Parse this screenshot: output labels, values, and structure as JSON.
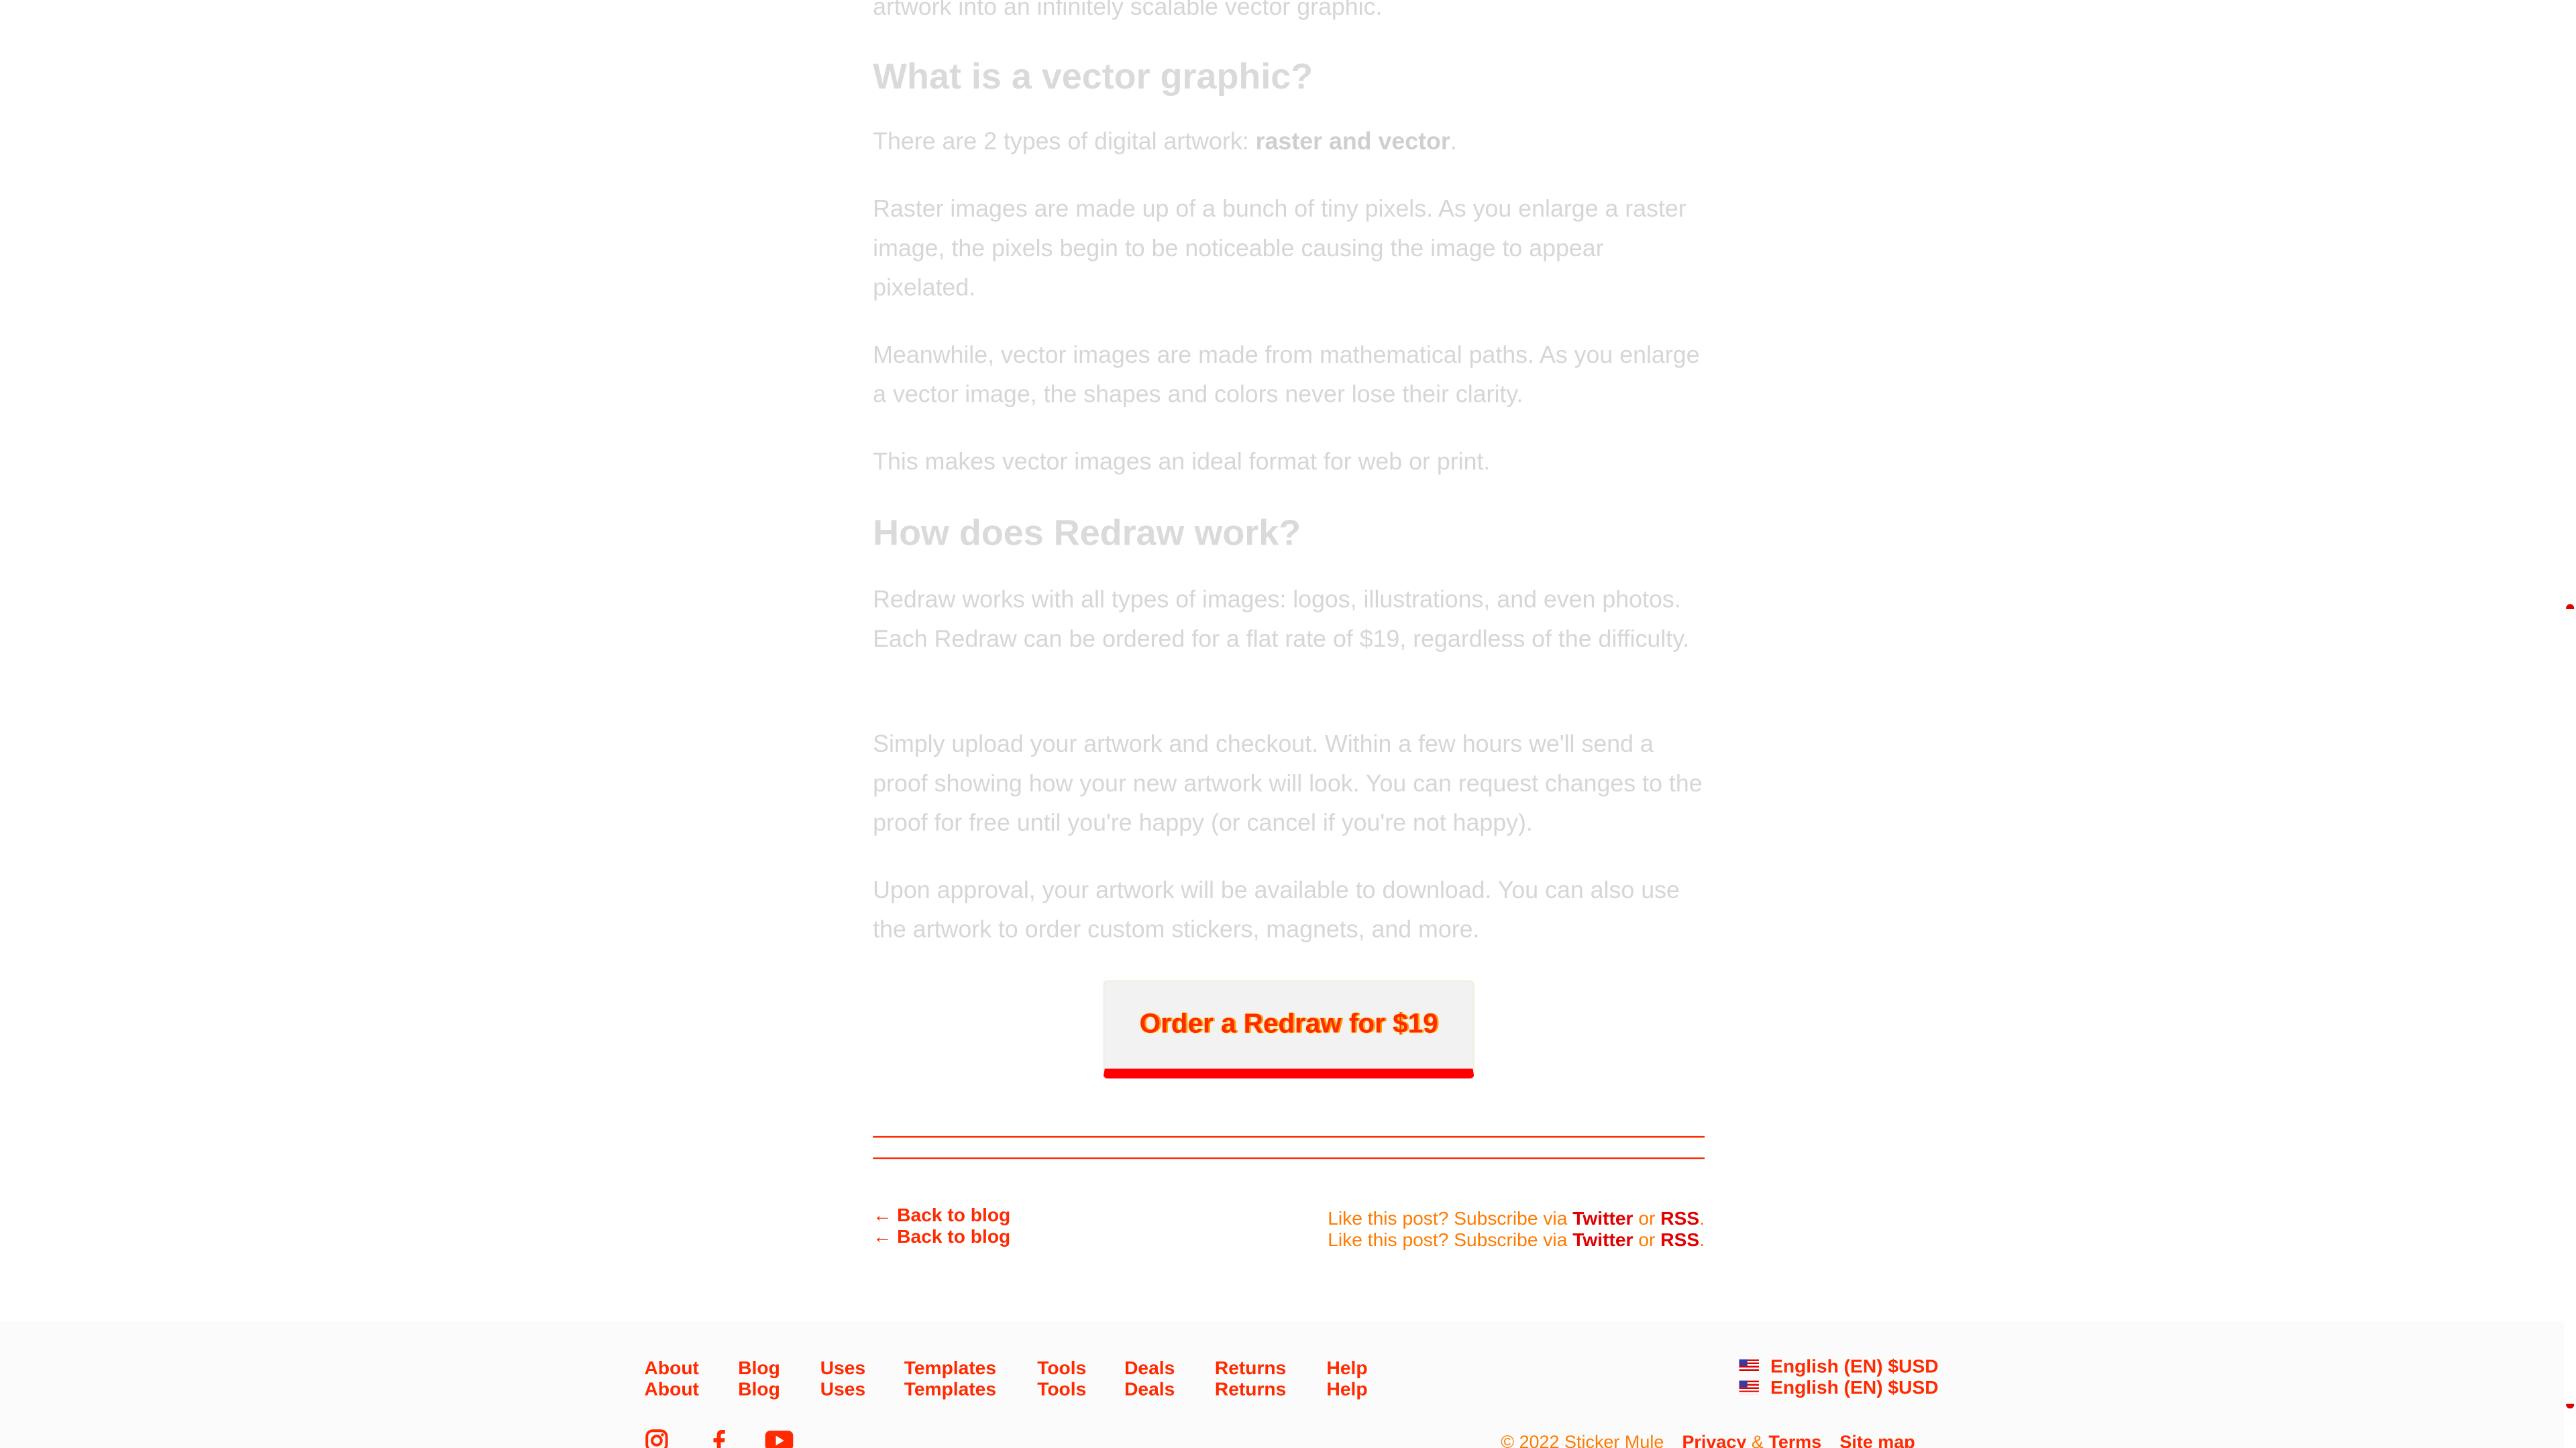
{
  "article": {
    "intro_tail": "artwork into an infinitely scalable vector graphic.",
    "h_vector": "What is a vector graphic?",
    "p_types_prefix": "There are 2 types of digital artwork: ",
    "p_types_strong": "raster and vector",
    "p_types_suffix": ".",
    "p_raster": "Raster images are made up of a bunch of tiny pixels. As you enlarge a raster image, the pixels begin to be noticeable causing the image to appear pixelated.",
    "p_vector": "Meanwhile, vector images are made from mathematical paths. As you enlarge a vector image, the shapes and colors never lose their clarity.",
    "p_ideal": "This makes vector images an ideal format for web or print.",
    "h_redraw": "How does Redraw work?",
    "p_works": "Redraw works with all types of images: logos, illustrations, and even photos. Each Redraw can be ordered for a flat rate of $19, regardless of the difficulty.",
    "p_upload": "Simply upload your artwork and checkout. Within a few hours we'll send a proof showing how your new artwork will look. You can request changes to the proof for free until you're happy (or cancel if you're not happy).",
    "p_approval": "Upon approval, your artwork will be available to download. You can also use the artwork to order custom stickers, magnets, and more."
  },
  "cta": {
    "label": "Order a Redraw for $19"
  },
  "post_nav": {
    "back_label": "← Back to blog",
    "subscribe_prefix": "Like this post? Subscribe via ",
    "twitter": "Twitter",
    "or": " or ",
    "rss": "RSS",
    "period": "."
  },
  "footer": {
    "nav": [
      "About",
      "Blog",
      "Uses",
      "Templates",
      "Tools",
      "Deals",
      "Returns",
      "Help"
    ],
    "language": "English (EN) $USD",
    "copyright": "© 2022 Sticker Mule",
    "privacy": "Privacy",
    "amp": " & ",
    "terms": "Terms",
    "sitemap": "Site map",
    "social_icons": [
      "instagram-icon",
      "facebook-icon",
      "youtube-icon"
    ]
  },
  "colors": {
    "accent": "#ff2a00",
    "muted_text": "#d6d6d6",
    "orange": "#ff7a00"
  }
}
